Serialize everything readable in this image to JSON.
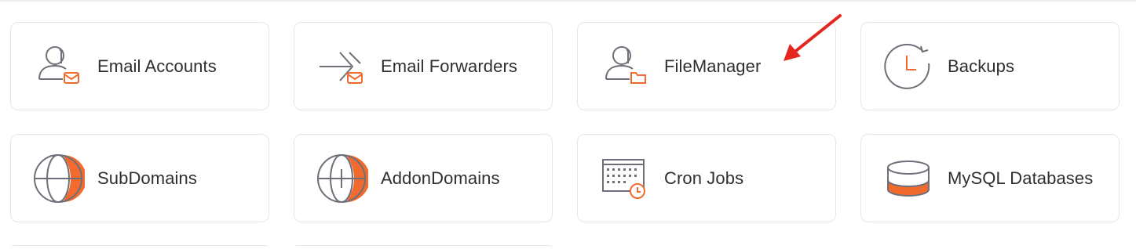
{
  "tiles": [
    {
      "label": "Email Accounts",
      "icon": "user-mail-icon"
    },
    {
      "label": "Email Forwarders",
      "icon": "forward-mail-icon"
    },
    {
      "label": "FileManager",
      "icon": "user-folder-icon"
    },
    {
      "label": "Backups",
      "icon": "backup-clock-icon"
    },
    {
      "label": "SubDomains",
      "icon": "globe-icon"
    },
    {
      "label": "AddonDomains",
      "icon": "globe-plus-icon"
    },
    {
      "label": "Cron Jobs",
      "icon": "calendar-clock-icon"
    },
    {
      "label": "MySQL Databases",
      "icon": "database-icon"
    }
  ],
  "colors": {
    "accent": "#f26b2e",
    "icon_stroke": "#6f6f7a",
    "annotation_arrow": "#e5261f"
  }
}
